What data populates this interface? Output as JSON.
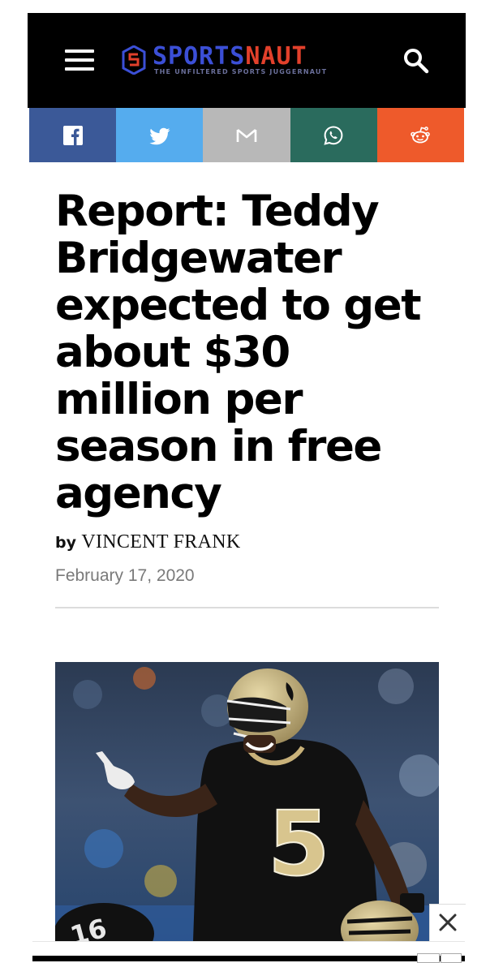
{
  "header": {
    "logo": {
      "word_part1": "SPORTS",
      "word_part2": "NAUT",
      "tagline": "THE UNFILTERED SPORTS JUGGERNAUT"
    },
    "menu_icon": "hamburger-menu-icon",
    "search_icon": "search-icon"
  },
  "share": [
    {
      "network": "facebook",
      "icon": "facebook-icon",
      "color": "#3b5998"
    },
    {
      "network": "twitter",
      "icon": "twitter-icon",
      "color": "#55acee"
    },
    {
      "network": "gmail",
      "icon": "gmail-icon",
      "color": "#b8b8b8"
    },
    {
      "network": "whatsapp",
      "icon": "whatsapp-icon",
      "color": "#2a6b5d"
    },
    {
      "network": "reddit",
      "icon": "reddit-icon",
      "color": "#ee5a2b"
    }
  ],
  "article": {
    "title": "Report: Teddy Bridgewater expected to get about $30 million per season in free agency",
    "by_label": "by",
    "author": "VINCENT FRANK",
    "date": "February 17, 2020"
  },
  "hero_image": {
    "jersey_number": "5"
  },
  "ad": {
    "close_icon": "close-icon"
  },
  "colors": {
    "brand_blue": "#3b4fd6",
    "brand_red": "#e2402b",
    "header_bg": "#000000"
  }
}
